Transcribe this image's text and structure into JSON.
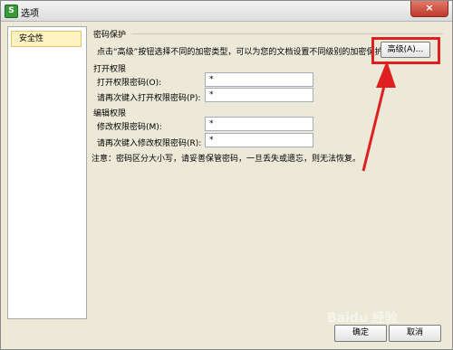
{
  "window": {
    "title": "选项",
    "app_icon_letter": "S",
    "close_glyph": "×"
  },
  "sidebar": {
    "items": [
      {
        "label": "安全性"
      }
    ]
  },
  "password_protection": {
    "group_title": "密码保护",
    "description": "点击“高级”按钮选择不同的加密类型，可以为您的文档设置不同级别的加密保护。",
    "advanced_button": "高级(A)...",
    "open_section_title": "打开权限",
    "open_password_label": "打开权限密码(O):",
    "open_password_value": "*",
    "open_confirm_label": "请再次键入打开权限密码(P):",
    "open_confirm_value": "*",
    "edit_section_title": "编辑权限",
    "edit_password_label": "修改权限密码(M):",
    "edit_password_value": "*",
    "edit_confirm_label": "请再次键入修改权限密码(R):",
    "edit_confirm_value": "*",
    "note": "注意：密码区分大小写，请妥善保管密码，一旦丢失或遗忘，则无法恢复。"
  },
  "footer": {
    "ok_label": "确定",
    "cancel_label": "取消"
  },
  "watermark": "Baidu 经验",
  "colors": {
    "highlight": "#e02020",
    "close_button": "#c0392b",
    "selected_item": "#fff3c2"
  }
}
